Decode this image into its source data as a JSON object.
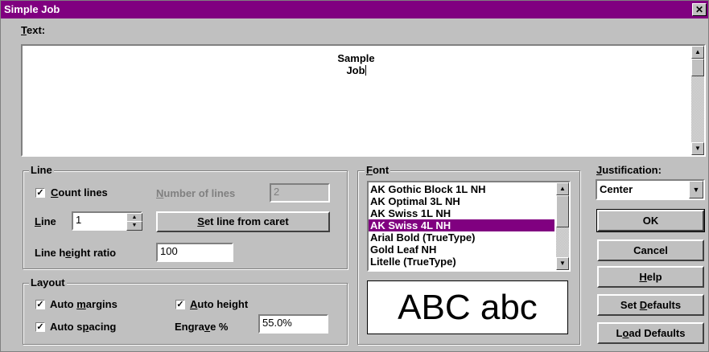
{
  "window": {
    "title": "Simple Job",
    "close_glyph": "✕"
  },
  "text_section": {
    "label_key": "T",
    "label_rest": "ext:",
    "lines": [
      "Sample",
      "Job"
    ]
  },
  "line_group": {
    "title": "Line",
    "count_lines": {
      "key": "C",
      "rest": "ount lines",
      "checked": true
    },
    "number_of_lines": {
      "key": "N",
      "rest": "umber of lines",
      "value": "2"
    },
    "line": {
      "key": "L",
      "rest": "ine",
      "value": "1"
    },
    "set_line_button": {
      "key": "S",
      "rest": "et line from caret"
    },
    "line_height_ratio": {
      "pre": "Line h",
      "key": "e",
      "rest": "ight ratio",
      "value": "100"
    }
  },
  "layout_group": {
    "title": "Layout",
    "auto_margins": {
      "pre": "Auto ",
      "key": "m",
      "rest": "argins",
      "checked": true
    },
    "auto_height": {
      "pre": "",
      "key": "A",
      "rest": "uto height",
      "checked": true
    },
    "auto_spacing": {
      "pre": "Auto s",
      "key": "p",
      "rest": "acing",
      "checked": true
    },
    "engrave": {
      "pre": "Engra",
      "key": "v",
      "rest": "e %",
      "value": "55.0%"
    }
  },
  "font_group": {
    "title_key": "F",
    "title_rest": "ont",
    "items": [
      "AK Gothic Block 1L NH",
      "AK Optimal 3L NH",
      "AK Swiss 1L NH",
      "AK Swiss 4L NH",
      "Arial Bold (TrueType)",
      "Gold Leaf NH",
      "Litelle (TrueType)"
    ],
    "selected": "AK Swiss 4L NH",
    "preview": "ABC abc"
  },
  "justification": {
    "key": "J",
    "rest": "ustification:",
    "value": "Center"
  },
  "buttons": {
    "ok": "OK",
    "cancel": "Cancel",
    "help": {
      "key": "H",
      "rest": "elp"
    },
    "set_defaults": {
      "pre": "Set ",
      "key": "D",
      "rest": "efaults"
    },
    "load_defaults": {
      "pre": "L",
      "key": "o",
      "rest": "ad Defaults"
    }
  },
  "colors": {
    "titlebar": "#800080",
    "selection": "#800080",
    "face": "#c0c0c0"
  }
}
